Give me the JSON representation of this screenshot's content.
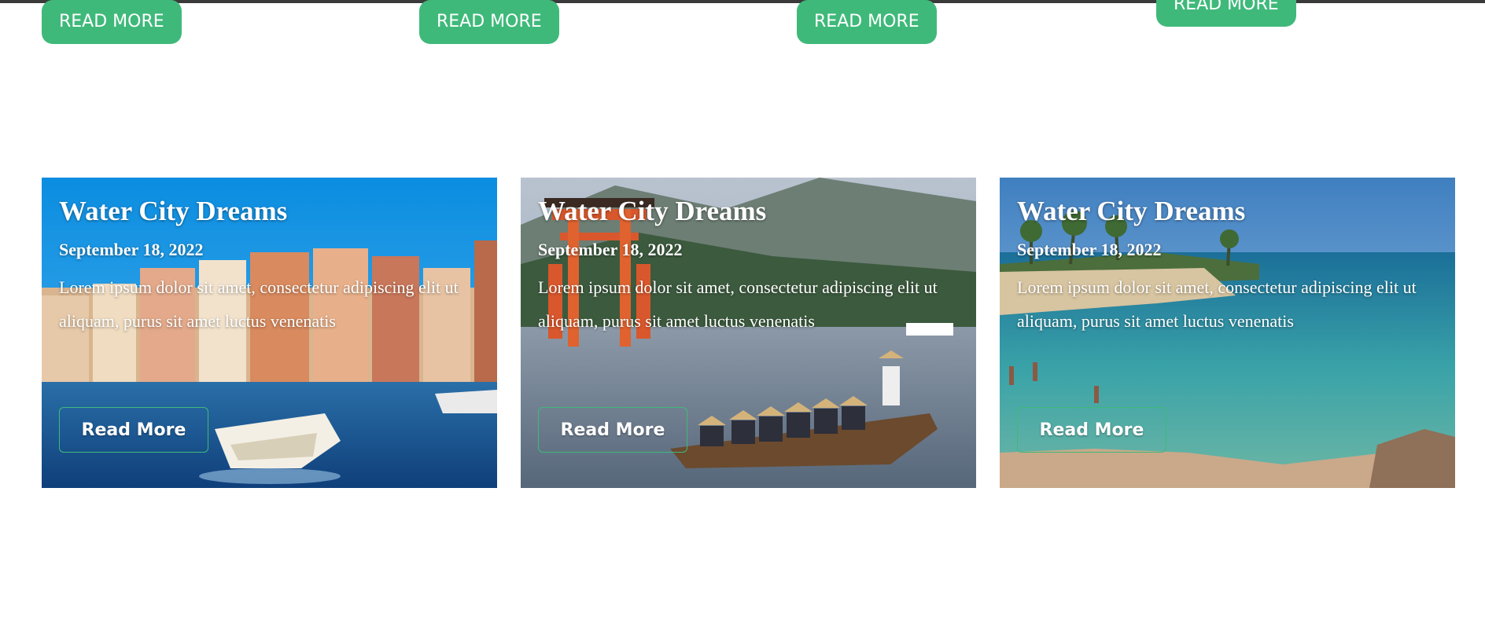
{
  "top_buttons": [
    {
      "label": "READ MORE"
    },
    {
      "label": "READ MORE"
    },
    {
      "label": "READ MORE"
    },
    {
      "label": "READ MORE"
    }
  ],
  "cards": [
    {
      "title": "Water City Dreams",
      "date": "September 18, 2022",
      "text": "Lorem ipsum dolor sit amet, consectetur adipiscing elit ut aliquam, purus sit amet luctus venenatis",
      "button_label": "Read More"
    },
    {
      "title": "Water City Dreams",
      "date": "September 18, 2022",
      "text": "Lorem ipsum dolor sit amet, consectetur adipiscing elit ut aliquam, purus sit amet luctus venenatis",
      "button_label": "Read More"
    },
    {
      "title": "Water City Dreams",
      "date": "September 18, 2022",
      "text": "Lorem ipsum dolor sit amet, consectetur adipiscing elit ut aliquam, purus sit amet luctus venenatis",
      "button_label": "Read More"
    }
  ],
  "colors": {
    "accent": "#3fb97a",
    "top_bar": "#3a3a3a"
  }
}
